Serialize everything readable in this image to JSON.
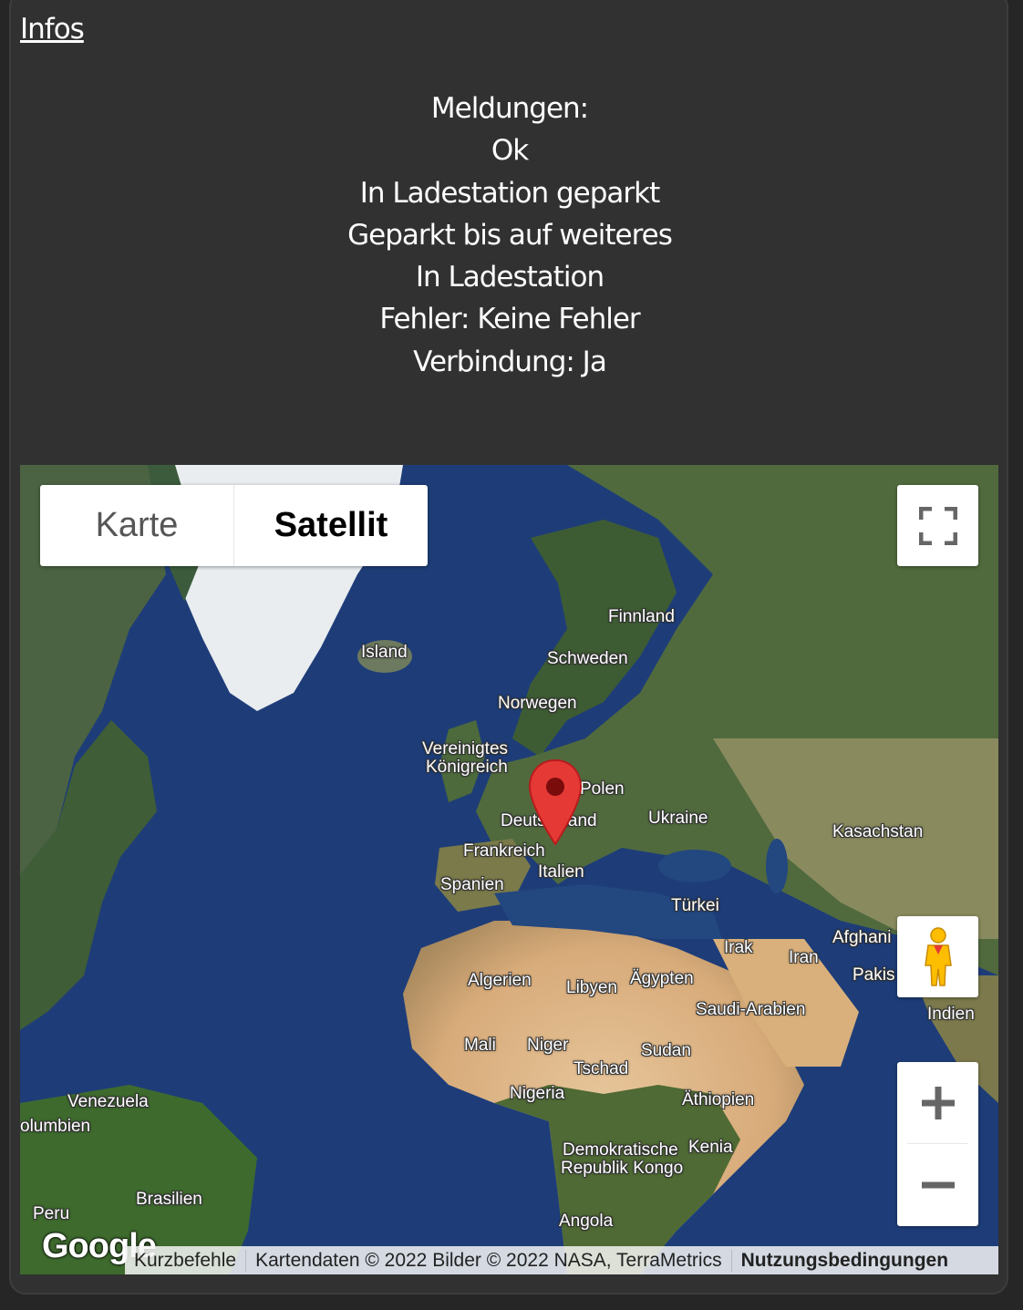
{
  "panel": {
    "title": "Infos",
    "messages": [
      "Meldungen:",
      "Ok",
      "In Ladestation geparkt",
      "Geparkt bis auf weiteres",
      "In Ladestation",
      "Fehler: Keine Fehler",
      "Verbindung: Ja"
    ]
  },
  "map": {
    "map_type_options": [
      "Karte",
      "Satellit"
    ],
    "selected_map_type": "Satellit",
    "labels": [
      "Finnland",
      "Island",
      "Schweden",
      "Norwegen",
      "Vereinigtes",
      "Königreich",
      "Polen",
      "Deutschland",
      "Ukraine",
      "Kasachstan",
      "Frankreich",
      "Spanien",
      "Italien",
      "Türkei",
      "Irak",
      "Iran",
      "Afghani",
      "Pakis",
      "Algerien",
      "Libyen",
      "Ägypten",
      "Saudi-Arabien",
      "Indien",
      "Mali",
      "Niger",
      "Sudan",
      "Tschad",
      "Venezuela",
      "olumbien",
      "Nigeria",
      "Äthiopien",
      "Demokratische",
      "Republik Kongo",
      "Kenia",
      "Brasilien",
      "Peru",
      "Angola"
    ],
    "logo": "Google",
    "attribution": {
      "shortcuts": "Kurzbefehle",
      "data": "Kartendaten © 2022 Bilder © 2022 NASA, TerraMetrics",
      "terms": "Nutzungsbedingungen"
    },
    "icons": {
      "fullscreen": "fullscreen-icon",
      "pegman": "street-view-pegman-icon",
      "zoom_in": "plus-icon",
      "zoom_out": "minus-icon",
      "marker": "map-marker-icon"
    },
    "marker_color": "#e53935"
  },
  "colors": {
    "panel_background": "#313131",
    "page_background": "#262626",
    "text": "#ffffff"
  }
}
